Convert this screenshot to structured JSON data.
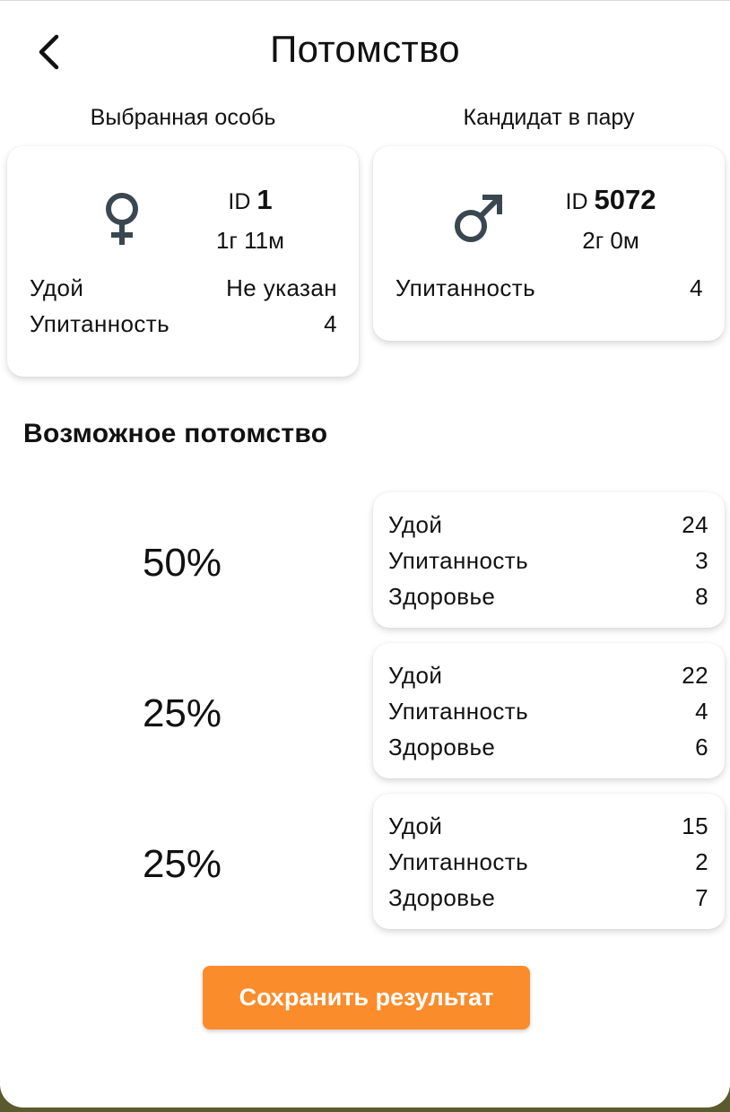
{
  "header": {
    "title": "Потомство",
    "back_icon": "chevron-left-icon"
  },
  "selected": {
    "label": "Выбранная особь",
    "sex_icon": "female-icon",
    "id_prefix": "ID",
    "id": "1",
    "age": "1г 11м",
    "rows": [
      {
        "label": "Удой",
        "value": "Не указан"
      },
      {
        "label": "Упитанность",
        "value": "4"
      }
    ]
  },
  "candidate": {
    "label": "Кандидат в пару",
    "sex_icon": "male-icon",
    "id_prefix": "ID",
    "id": "5072",
    "age": "2г 0м",
    "rows": [
      {
        "label": "Упитанность",
        "value": "4"
      }
    ]
  },
  "offspring": {
    "title": "Возможное потомство",
    "items": [
      {
        "percent": "50%",
        "rows": [
          {
            "label": "Удой",
            "value": "24"
          },
          {
            "label": "Упитанность",
            "value": "3"
          },
          {
            "label": "Здоровье",
            "value": "8"
          }
        ]
      },
      {
        "percent": "25%",
        "rows": [
          {
            "label": "Удой",
            "value": "22"
          },
          {
            "label": "Упитанность",
            "value": "4"
          },
          {
            "label": "Здоровье",
            "value": "6"
          }
        ]
      },
      {
        "percent": "25%",
        "rows": [
          {
            "label": "Удой",
            "value": "15"
          },
          {
            "label": "Упитанность",
            "value": "2"
          },
          {
            "label": "Здоровье",
            "value": "7"
          }
        ]
      }
    ]
  },
  "save_button": {
    "label": "Сохранить результат"
  },
  "colors": {
    "accent": "#fb8c2b",
    "icon": "#3a4750"
  }
}
